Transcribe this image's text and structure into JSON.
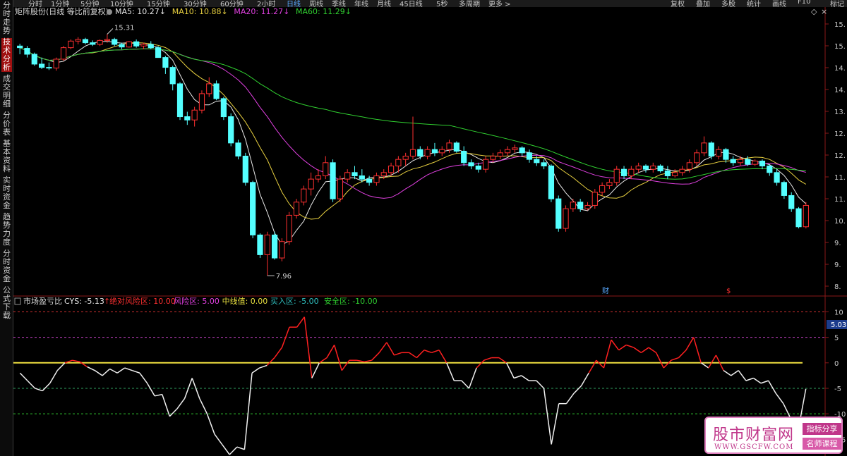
{
  "top_bar": {
    "periods": [
      "分时",
      "1分钟",
      "5分钟",
      "10分钟",
      "15分钟",
      "30分钟",
      "60分钟",
      "2小时",
      "日线",
      "周线",
      "季线",
      "年线",
      "月线",
      "45日线",
      "5秒",
      "多周期",
      "更多 >"
    ],
    "active_period": "日线",
    "right_buttons": [
      "复权",
      "叠加",
      "多股",
      "统计",
      "画线",
      "F10",
      "标记",
      "+自选",
      "返"
    ]
  },
  "left_nav": [
    "分时走势",
    "技术分析",
    "成交明细",
    "分价表",
    "基本资料",
    "实时资金",
    "趋势力度",
    "分时资金",
    "公式下载"
  ],
  "left_nav_active": "技术分析",
  "price_panel": {
    "stock_title": "矩阵股份(日线 等比前复权)",
    "ma_labels": [
      {
        "text": "MA5: 10.27",
        "arrow": "↓",
        "color": "#e8e8e8"
      },
      {
        "text": "MA10: 10.88",
        "arrow": "↓",
        "color": "#e8d040"
      },
      {
        "text": "MA20: 11.27",
        "arrow": "↓",
        "color": "#e040e0"
      },
      {
        "text": "MA60: 11.29",
        "arrow": "↓",
        "color": "#30d030"
      }
    ],
    "high_label": "15.31",
    "low_label": "7.96",
    "marker_cai": "财",
    "marker_s": "$",
    "y_ticks": [
      "15.",
      "15.",
      "14.",
      "14.",
      "13.",
      "12.",
      "12.",
      "11.",
      "11.",
      "10.",
      "9.",
      "9.",
      "8."
    ]
  },
  "indicator_panel": {
    "name": "市场盈亏比",
    "cys_label": "CYS: -5.13",
    "cys_arrow": "↑",
    "legend": [
      {
        "text": "绝对风险区: 10.00",
        "color": "#ff3030"
      },
      {
        "text": "风险区: 5.00",
        "color": "#e040e0"
      },
      {
        "text": "中线值: 0.00",
        "color": "#e8e040"
      },
      {
        "text": "买入区: -5.00",
        "color": "#30c0c0"
      },
      {
        "text": "安全区: -10.00",
        "color": "#30d030"
      }
    ],
    "current_value_badge": "5.03",
    "y_ticks": [
      "10",
      "5",
      "0",
      "-5",
      "-10",
      "-15"
    ]
  },
  "watermark": {
    "name": "股市财富网",
    "url": "WWW.GSCFW.COM",
    "tag1": "指标分享",
    "tag2": "名师课程"
  },
  "chart_data": {
    "type": "candlestick",
    "price_range": [
      7.6,
      15.75
    ],
    "candles": [
      [
        14.95,
        15.02,
        14.7,
        14.9
      ],
      [
        14.88,
        14.95,
        14.6,
        14.7
      ],
      [
        14.7,
        14.75,
        14.35,
        14.4
      ],
      [
        14.4,
        14.6,
        14.25,
        14.3
      ],
      [
        14.3,
        14.45,
        14.22,
        14.28
      ],
      [
        14.28,
        14.6,
        14.2,
        14.55
      ],
      [
        14.55,
        14.95,
        14.5,
        14.9
      ],
      [
        14.9,
        15.15,
        14.85,
        15.1
      ],
      [
        15.1,
        15.22,
        15.0,
        15.15
      ],
      [
        15.15,
        15.2,
        15.0,
        15.05
      ],
      [
        15.05,
        15.12,
        14.95,
        15.0
      ],
      [
        15.0,
        15.15,
        14.95,
        15.12
      ],
      [
        15.12,
        15.31,
        15.05,
        15.15
      ],
      [
        15.15,
        15.2,
        14.95,
        15.0
      ],
      [
        15.0,
        15.05,
        14.85,
        14.92
      ],
      [
        14.92,
        15.1,
        14.9,
        15.08
      ],
      [
        15.08,
        15.15,
        14.9,
        14.95
      ],
      [
        14.95,
        15.05,
        14.85,
        15.0
      ],
      [
        15.0,
        15.1,
        14.85,
        14.9
      ],
      [
        14.9,
        14.95,
        14.6,
        14.6
      ],
      [
        14.6,
        14.65,
        14.1,
        14.3
      ],
      [
        14.3,
        14.35,
        13.6,
        13.8
      ],
      [
        13.8,
        13.85,
        12.7,
        12.8
      ],
      [
        12.8,
        12.95,
        12.55,
        12.7
      ],
      [
        12.7,
        13.1,
        12.5,
        13.0
      ],
      [
        13.0,
        13.6,
        12.9,
        13.5
      ],
      [
        13.5,
        14.0,
        13.4,
        13.8
      ],
      [
        13.8,
        13.9,
        13.3,
        13.35
      ],
      [
        13.35,
        13.4,
        12.7,
        12.8
      ],
      [
        12.8,
        12.9,
        11.9,
        12.0
      ],
      [
        12.0,
        12.1,
        11.5,
        11.6
      ],
      [
        11.6,
        11.7,
        10.7,
        10.8
      ],
      [
        10.8,
        10.85,
        9.1,
        9.2
      ],
      [
        9.2,
        9.25,
        8.5,
        8.6
      ],
      [
        8.6,
        9.3,
        7.96,
        9.2
      ],
      [
        9.2,
        9.3,
        8.45,
        8.5
      ],
      [
        8.5,
        9.1,
        8.4,
        9.0
      ],
      [
        9.0,
        9.9,
        8.9,
        9.8
      ],
      [
        9.8,
        10.3,
        9.7,
        10.2
      ],
      [
        10.2,
        10.7,
        10.1,
        10.6
      ],
      [
        10.6,
        11.1,
        10.4,
        10.9
      ],
      [
        10.9,
        11.2,
        10.8,
        11.0
      ],
      [
        11.0,
        11.6,
        10.9,
        11.4
      ],
      [
        11.4,
        11.5,
        10.2,
        10.3
      ],
      [
        10.3,
        11.0,
        10.2,
        10.9
      ],
      [
        10.9,
        11.2,
        10.8,
        11.1
      ],
      [
        11.1,
        11.3,
        10.9,
        11.0
      ],
      [
        11.0,
        11.2,
        10.8,
        10.9
      ],
      [
        10.9,
        11.0,
        10.7,
        10.8
      ],
      [
        10.8,
        11.1,
        10.7,
        11.0
      ],
      [
        11.0,
        11.2,
        10.9,
        11.1
      ],
      [
        11.1,
        11.4,
        11.0,
        11.3
      ],
      [
        11.3,
        11.6,
        11.1,
        11.5
      ],
      [
        11.5,
        11.7,
        11.3,
        11.6
      ],
      [
        11.6,
        12.8,
        11.5,
        11.8
      ],
      [
        11.8,
        11.9,
        11.5,
        11.6
      ],
      [
        11.6,
        11.9,
        11.5,
        11.8
      ],
      [
        11.8,
        12.0,
        11.6,
        11.7
      ],
      [
        11.7,
        11.9,
        11.6,
        11.8
      ],
      [
        11.8,
        12.1,
        11.7,
        12.0
      ],
      [
        12.0,
        12.05,
        11.7,
        11.75
      ],
      [
        11.75,
        11.9,
        11.3,
        11.4
      ],
      [
        11.4,
        11.5,
        11.2,
        11.3
      ],
      [
        11.3,
        11.4,
        11.1,
        11.2
      ],
      [
        11.2,
        11.6,
        11.1,
        11.5
      ],
      [
        11.5,
        11.7,
        11.4,
        11.6
      ],
      [
        11.6,
        11.8,
        11.5,
        11.7
      ],
      [
        11.7,
        11.9,
        11.6,
        11.8
      ],
      [
        11.8,
        11.95,
        11.7,
        11.85
      ],
      [
        11.85,
        11.9,
        11.6,
        11.7
      ],
      [
        11.7,
        11.8,
        11.4,
        11.5
      ],
      [
        11.5,
        11.6,
        11.3,
        11.4
      ],
      [
        11.4,
        11.5,
        11.2,
        11.3
      ],
      [
        11.3,
        11.35,
        10.2,
        10.3
      ],
      [
        10.3,
        10.4,
        9.3,
        9.4
      ],
      [
        9.4,
        10.1,
        9.3,
        10.0
      ],
      [
        10.0,
        10.3,
        9.9,
        10.2
      ],
      [
        10.2,
        10.3,
        9.9,
        10.0
      ],
      [
        10.0,
        10.2,
        9.95,
        10.1
      ],
      [
        10.1,
        10.6,
        10.0,
        10.5
      ],
      [
        10.5,
        10.8,
        10.4,
        10.7
      ],
      [
        10.7,
        10.9,
        10.6,
        10.8
      ],
      [
        10.8,
        11.3,
        10.7,
        11.2
      ],
      [
        11.2,
        11.3,
        10.9,
        11.0
      ],
      [
        11.0,
        11.3,
        10.9,
        11.2
      ],
      [
        11.2,
        11.4,
        11.1,
        11.3
      ],
      [
        11.3,
        11.35,
        11.1,
        11.2
      ],
      [
        11.2,
        11.4,
        11.1,
        11.3
      ],
      [
        11.3,
        11.35,
        11.1,
        11.15
      ],
      [
        11.15,
        11.3,
        10.9,
        11.0
      ],
      [
        11.0,
        11.2,
        10.95,
        11.1
      ],
      [
        11.1,
        11.3,
        11.0,
        11.2
      ],
      [
        11.2,
        11.5,
        11.1,
        11.4
      ],
      [
        11.4,
        11.8,
        11.3,
        11.7
      ],
      [
        11.7,
        12.2,
        11.6,
        12.0
      ],
      [
        12.0,
        12.05,
        11.5,
        11.6
      ],
      [
        11.6,
        11.9,
        11.5,
        11.8
      ],
      [
        11.8,
        11.85,
        11.4,
        11.5
      ],
      [
        11.5,
        11.6,
        11.3,
        11.4
      ],
      [
        11.4,
        11.6,
        11.3,
        11.5
      ],
      [
        11.5,
        11.6,
        11.3,
        11.35
      ],
      [
        11.35,
        11.5,
        11.3,
        11.45
      ],
      [
        11.45,
        11.5,
        11.2,
        11.3
      ],
      [
        11.3,
        11.35,
        11.0,
        11.1
      ],
      [
        11.1,
        11.2,
        10.7,
        10.8
      ],
      [
        10.8,
        10.85,
        10.3,
        10.4
      ],
      [
        10.4,
        10.5,
        9.9,
        10.0
      ],
      [
        10.0,
        10.05,
        9.4,
        9.45
      ],
      [
        9.45,
        10.2,
        9.4,
        10.1
      ]
    ],
    "ma5_last": 10.27,
    "ma10_last": 10.88,
    "ma20_last": 11.27,
    "ma60_last": 11.29,
    "cys_range": [
      -18,
      12
    ],
    "cys": [
      -2,
      -3.5,
      -5,
      -5.5,
      -4,
      -1.5,
      0,
      0.5,
      0.2,
      -0.8,
      -1.5,
      -2.5,
      -1.2,
      -2,
      -1,
      -1.5,
      -2,
      -4,
      -6.5,
      -6.2,
      -10.5,
      -9,
      -7,
      -3,
      -7,
      -10,
      -14,
      -16,
      -18,
      -16.5,
      -17,
      -2,
      -1,
      -0.5,
      1,
      3,
      7,
      7,
      9,
      -3,
      0,
      1,
      3.5,
      -1.5,
      0.5,
      0.5,
      0.2,
      0.5,
      2,
      4,
      1.5,
      2,
      2,
      1,
      2.5,
      2,
      2.5,
      0,
      -3.5,
      -3.5,
      -5,
      -1,
      0.5,
      1,
      1,
      0,
      -3,
      -2.5,
      -3.5,
      -3.5,
      -5,
      -16,
      -8,
      -8,
      -6,
      -4.5,
      -2,
      0.5,
      -1,
      4.5,
      2.5,
      3.5,
      3,
      2,
      3,
      2,
      -1,
      0.5,
      1,
      2.5,
      5,
      0,
      -1,
      1.5,
      -1.5,
      -2.5,
      -1.5,
      -3.5,
      -3,
      -4,
      -3.5,
      -6,
      -8,
      -11,
      -13,
      -5.13
    ]
  }
}
